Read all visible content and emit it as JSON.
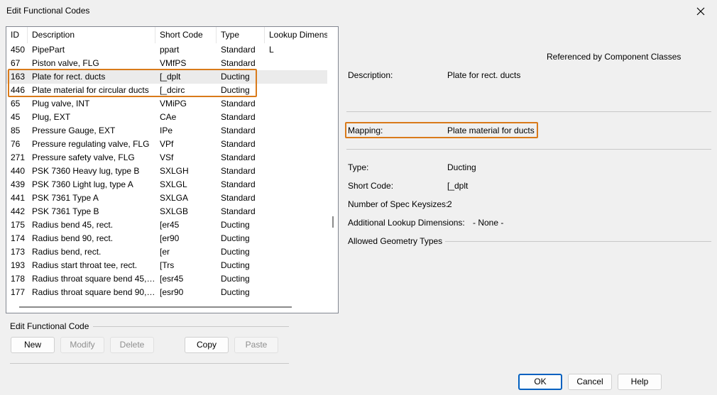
{
  "window": {
    "title": "Edit Functional Codes"
  },
  "table": {
    "headers": {
      "id": "ID",
      "description": "Description",
      "short_code": "Short Code",
      "type": "Type",
      "lookup": "Lookup Dimens"
    },
    "rows": [
      {
        "id": "450",
        "description": "PipePart",
        "short_code": "ppart",
        "type": "Standard",
        "lookup": "L"
      },
      {
        "id": "67",
        "description": "Piston valve, FLG",
        "short_code": "VMfPS",
        "type": "Standard",
        "lookup": ""
      },
      {
        "id": "163",
        "description": "Plate for rect. ducts",
        "short_code": "[_dplt",
        "type": "Ducting",
        "lookup": ""
      },
      {
        "id": "446",
        "description": "Plate material for circular ducts",
        "short_code": "[_dcirc",
        "type": "Ducting",
        "lookup": ""
      },
      {
        "id": "65",
        "description": "Plug valve, INT",
        "short_code": "VMiPG",
        "type": "Standard",
        "lookup": ""
      },
      {
        "id": "45",
        "description": "Plug, EXT",
        "short_code": "CAe",
        "type": "Standard",
        "lookup": ""
      },
      {
        "id": "85",
        "description": "Pressure Gauge, EXT",
        "short_code": "IPe",
        "type": "Standard",
        "lookup": ""
      },
      {
        "id": "76",
        "description": "Pressure regulating valve, FLG",
        "short_code": "VPf",
        "type": "Standard",
        "lookup": ""
      },
      {
        "id": "271",
        "description": "Pressure safety valve, FLG",
        "short_code": "VSf",
        "type": "Standard",
        "lookup": ""
      },
      {
        "id": "440",
        "description": "PSK 7360 Heavy lug, type B",
        "short_code": "SXLGH",
        "type": "Standard",
        "lookup": ""
      },
      {
        "id": "439",
        "description": "PSK 7360 Light lug, type A",
        "short_code": "SXLGL",
        "type": "Standard",
        "lookup": ""
      },
      {
        "id": "441",
        "description": "PSK 7361 Type A",
        "short_code": "SXLGA",
        "type": "Standard",
        "lookup": ""
      },
      {
        "id": "442",
        "description": "PSK 7361 Type B",
        "short_code": "SXLGB",
        "type": "Standard",
        "lookup": ""
      },
      {
        "id": "175",
        "description": "Radius bend 45, rect.",
        "short_code": "[er45",
        "type": "Ducting",
        "lookup": ""
      },
      {
        "id": "174",
        "description": "Radius bend 90, rect.",
        "short_code": "[er90",
        "type": "Ducting",
        "lookup": ""
      },
      {
        "id": "173",
        "description": "Radius bend, rect.",
        "short_code": "[er",
        "type": "Ducting",
        "lookup": ""
      },
      {
        "id": "193",
        "description": "Radius start throat tee, rect.",
        "short_code": "[Trs",
        "type": "Ducting",
        "lookup": ""
      },
      {
        "id": "178",
        "description": "Radius throat square bend 45, ...",
        "short_code": "[esr45",
        "type": "Ducting",
        "lookup": ""
      },
      {
        "id": "177",
        "description": "Radius throat square bend 90, ...",
        "short_code": "[esr90",
        "type": "Ducting",
        "lookup": ""
      }
    ]
  },
  "edit_group": {
    "label": "Edit Functional Code",
    "new": "New",
    "modify": "Modify",
    "delete": "Delete",
    "copy": "Copy",
    "paste": "Paste"
  },
  "details": {
    "referenced_by": "Referenced by Component Classes",
    "description_label": "Description:",
    "description_value": "Plate for rect. ducts",
    "mapping_label": "Mapping:",
    "mapping_value": "Plate material for ducts",
    "type_label": "Type:",
    "type_value": "Ducting",
    "short_code_label": "Short Code:",
    "short_code_value": "[_dplt",
    "keysizes_label": "Number of Spec Keysizes:",
    "keysizes_value": "2",
    "additional_label": "Additional Lookup Dimensions:",
    "additional_value": "- None -",
    "geometry_label": "Allowed Geometry Types"
  },
  "footer": {
    "ok": "OK",
    "cancel": "Cancel",
    "help": "Help"
  },
  "colors": {
    "highlight": "#d97a1a",
    "default_button": "#0060c0"
  },
  "icons": {
    "close": "close-icon"
  }
}
